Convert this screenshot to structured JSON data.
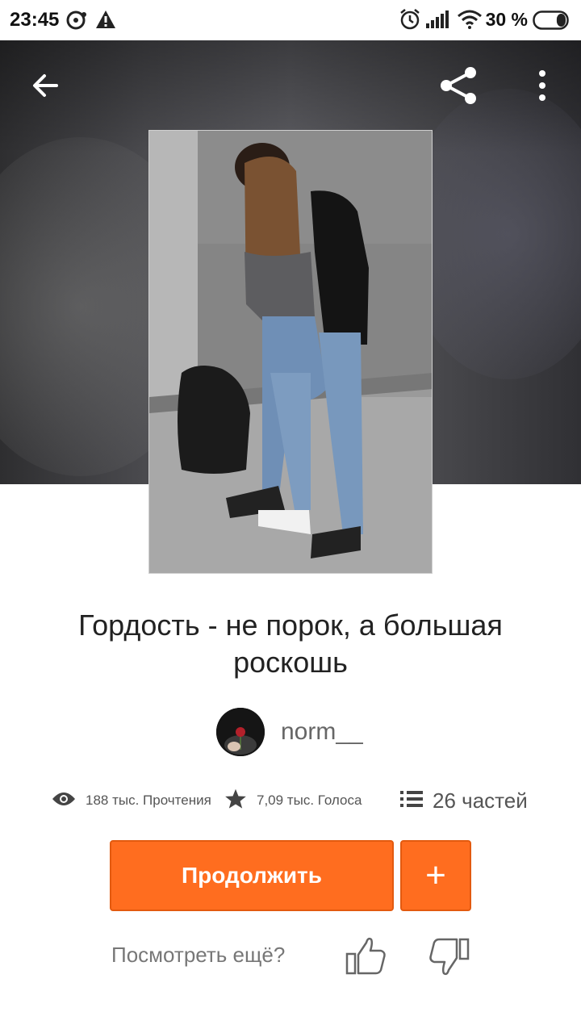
{
  "status_bar": {
    "time": "23:45",
    "battery_percent": "30 %",
    "battery_level": 0.3,
    "icons": [
      "sync-icon",
      "warning-icon",
      "alarm-icon",
      "signal-icon",
      "wifi-icon",
      "battery-icon"
    ]
  },
  "toolbar": {
    "icons": [
      "back-arrow-icon",
      "share-icon",
      "more-vertical-icon"
    ]
  },
  "story": {
    "title": "Гордость - не порок, а большая роскошь",
    "author": "norm__"
  },
  "stats": {
    "reads": "188 тыс. Прочтения",
    "votes": "7,09 тыс. Голоса",
    "parts": "26 частей",
    "icons": [
      "eye-icon",
      "star-icon",
      "list-icon"
    ]
  },
  "actions": {
    "continue_label": "Продолжить",
    "add_label": "+"
  },
  "feedback": {
    "question": "Посмотреть ещё?",
    "icons": [
      "thumbs-up-icon",
      "thumbs-down-icon"
    ]
  },
  "colors": {
    "accent": "#ff6d1f",
    "text_primary": "#222222",
    "text_secondary": "#666666"
  }
}
